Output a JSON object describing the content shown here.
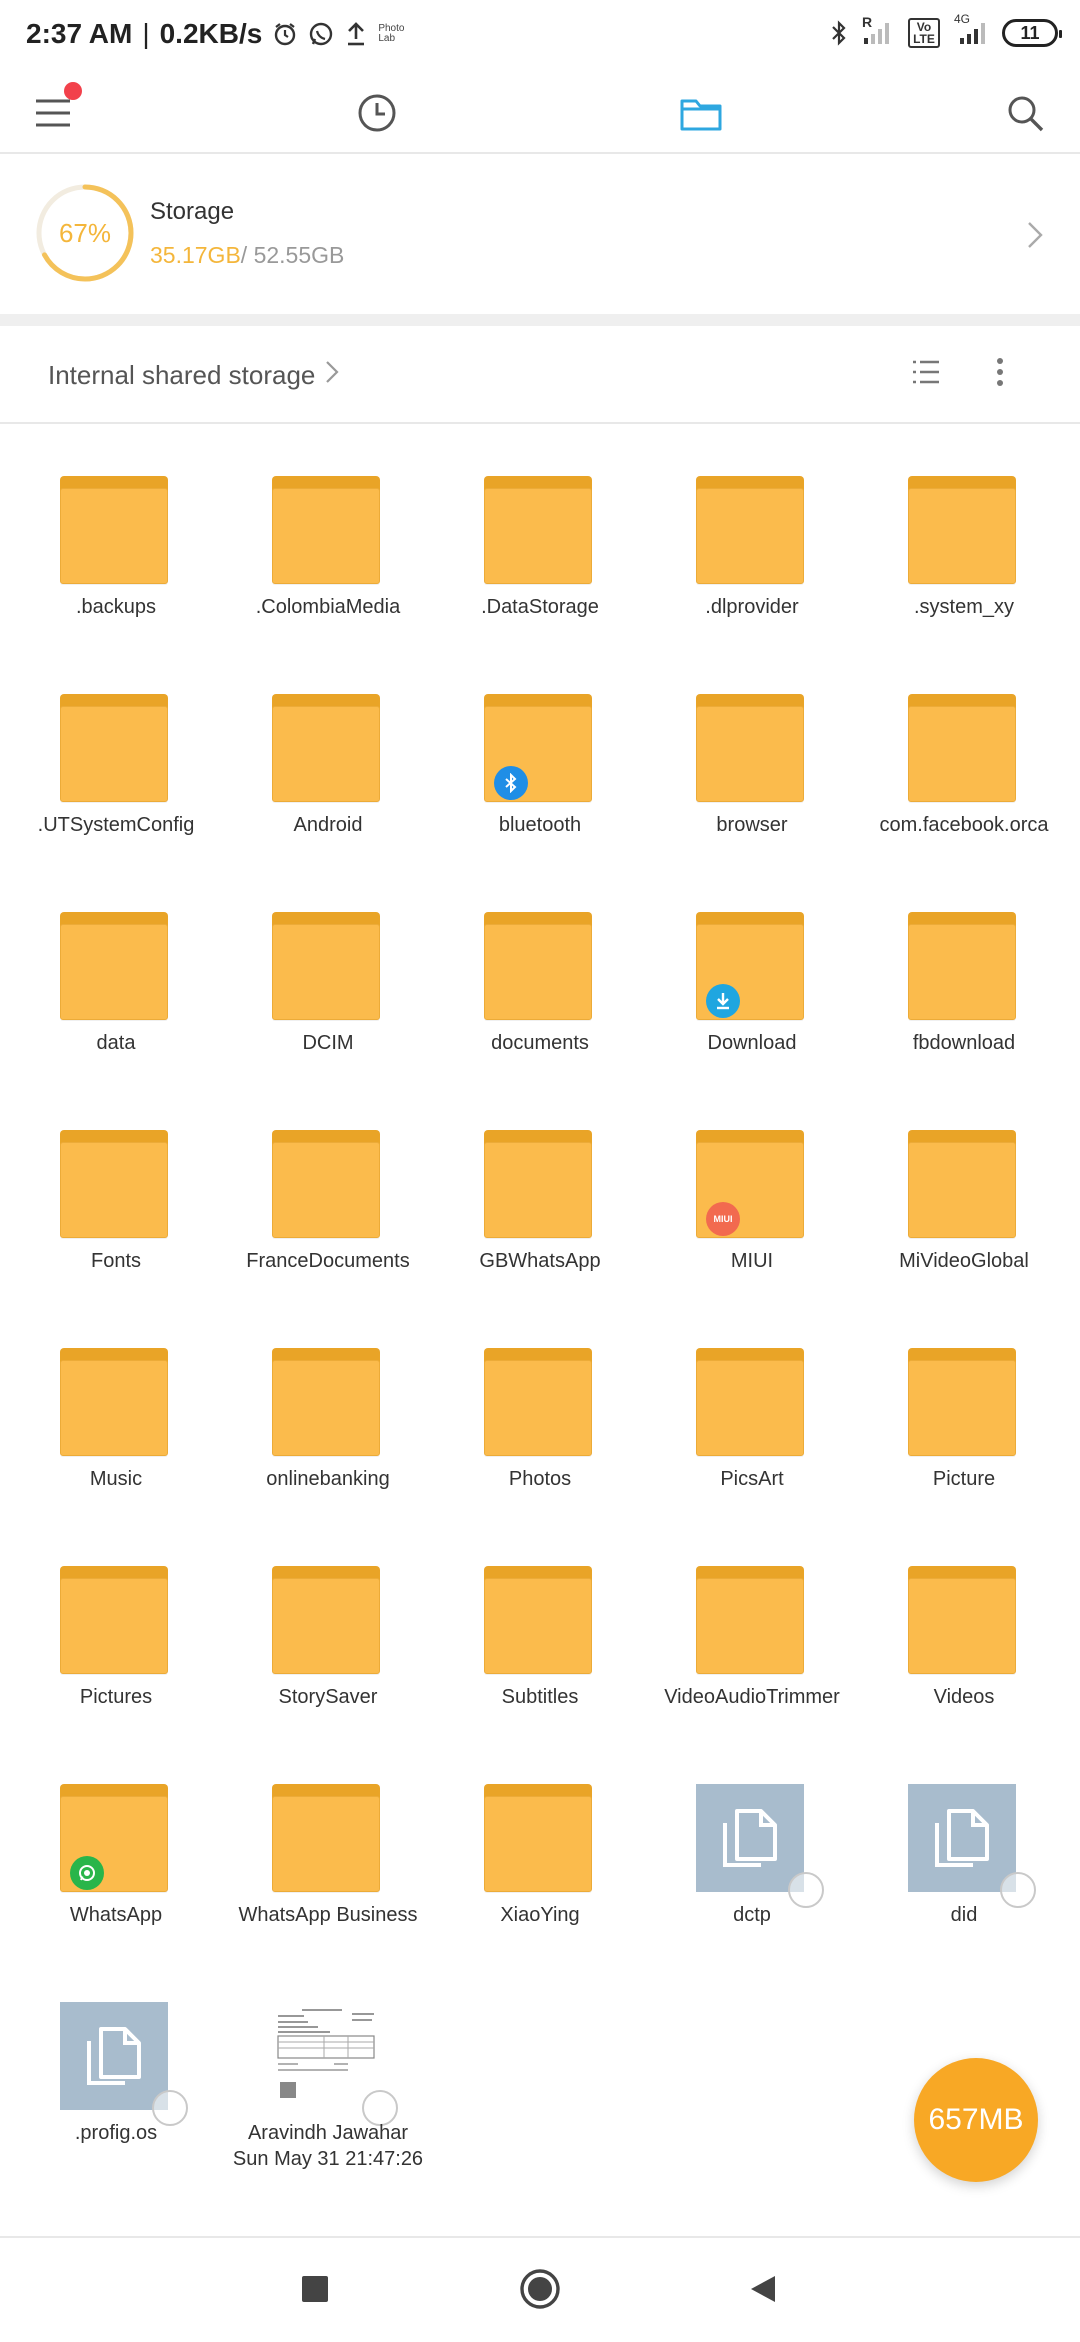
{
  "status_bar": {
    "time": "2:37 AM",
    "separator": "|",
    "speed": "0.2KB/s",
    "photolab_line1": "Photo",
    "photolab_line2": "Lab",
    "roaming": "R",
    "network": "4G",
    "volte": "Vo LTE",
    "battery": "11",
    "icons": [
      "alarm-icon",
      "whatsapp-icon",
      "upload-icon",
      "bluetooth-icon",
      "signal-icon"
    ]
  },
  "top_nav": {
    "icons": [
      "menu-icon",
      "recent-clock-icon",
      "folder-icon",
      "search-icon"
    ],
    "active_color": "#2ea7e0",
    "notification_dot_color": "#f2414b"
  },
  "storage": {
    "percent": "67%",
    "title": "Storage",
    "used": "35.17GB",
    "total": "/ 52.55GB",
    "fraction": 0.67,
    "accent": "#f4b63b"
  },
  "path": {
    "label": "Internal shared storage"
  },
  "items": [
    {
      "name": ".backups",
      "type": "folder"
    },
    {
      "name": ".ColombiaMedia",
      "type": "folder"
    },
    {
      "name": ".DataStorage",
      "type": "folder"
    },
    {
      "name": ".dlprovider",
      "type": "folder"
    },
    {
      "name": ".system_xy",
      "type": "folder"
    },
    {
      "name": ".UTSystemConfig",
      "type": "folder"
    },
    {
      "name": "Android",
      "type": "folder"
    },
    {
      "name": "bluetooth",
      "type": "folder",
      "badge": "bluetooth"
    },
    {
      "name": "browser",
      "type": "folder"
    },
    {
      "name": "com.facebook.orca",
      "type": "folder"
    },
    {
      "name": "data",
      "type": "folder"
    },
    {
      "name": "DCIM",
      "type": "folder"
    },
    {
      "name": "documents",
      "type": "folder"
    },
    {
      "name": "Download",
      "type": "folder",
      "badge": "download"
    },
    {
      "name": "fbdownload",
      "type": "folder"
    },
    {
      "name": "Fonts",
      "type": "folder"
    },
    {
      "name": "FranceDocuments",
      "type": "folder"
    },
    {
      "name": "GBWhatsApp",
      "type": "folder"
    },
    {
      "name": "MIUI",
      "type": "folder",
      "badge": "miui"
    },
    {
      "name": "MiVideoGlobal",
      "type": "folder"
    },
    {
      "name": "Music",
      "type": "folder"
    },
    {
      "name": "onlinebanking",
      "type": "folder"
    },
    {
      "name": "Photos",
      "type": "folder"
    },
    {
      "name": "PicsArt",
      "type": "folder"
    },
    {
      "name": "Picture",
      "type": "folder"
    },
    {
      "name": "Pictures",
      "type": "folder"
    },
    {
      "name": "StorySaver",
      "type": "folder"
    },
    {
      "name": "Subtitles",
      "type": "folder"
    },
    {
      "name": "VideoAudioTrimmer",
      "type": "folder"
    },
    {
      "name": "Videos",
      "type": "folder"
    },
    {
      "name": "WhatsApp",
      "type": "folder",
      "badge": "whatsapp"
    },
    {
      "name": "WhatsApp Business",
      "type": "folder"
    },
    {
      "name": "XiaoYing",
      "type": "folder"
    },
    {
      "name": "dctp",
      "type": "file"
    },
    {
      "name": "did",
      "type": "file"
    },
    {
      "name": ".profig.os",
      "type": "file"
    },
    {
      "name": "Aravindh Jawahar",
      "name2": "Sun May 31 21:47:26",
      "type": "document"
    }
  ],
  "badges": {
    "bluetooth": {
      "color": "#1f8ee6",
      "icon": "bluetooth-icon"
    },
    "download": {
      "color": "#1fa6e0",
      "icon": "download-icon"
    },
    "miui": {
      "color": "#f26a4f",
      "text": "MIUI",
      "icon": "miui-icon"
    },
    "whatsapp": {
      "color": "#29b54a",
      "icon": "whatsapp-icon"
    }
  },
  "fab": {
    "label": "657MB",
    "color": "#f8a825"
  },
  "nav_bar": {
    "icons": [
      "recents-square-icon",
      "home-circle-icon",
      "back-triangle-icon"
    ]
  }
}
